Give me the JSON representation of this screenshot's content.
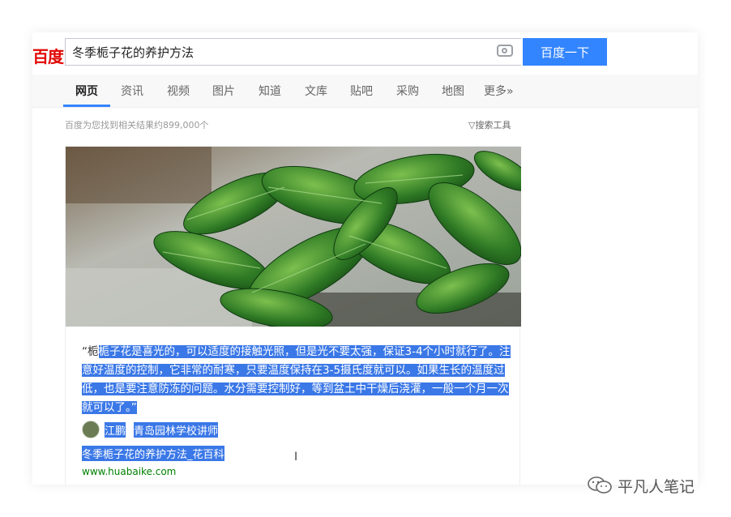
{
  "logo": "百度",
  "search": {
    "value": "冬季栀子花的养护方法",
    "button": "百度一下"
  },
  "nav": {
    "tabs": [
      {
        "label": "网页",
        "active": true
      },
      {
        "label": "资讯"
      },
      {
        "label": "视频"
      },
      {
        "label": "图片"
      },
      {
        "label": "知道"
      },
      {
        "label": "文库"
      },
      {
        "label": "贴吧"
      },
      {
        "label": "采购"
      },
      {
        "label": "地图"
      },
      {
        "label": "更多»"
      }
    ]
  },
  "results": {
    "count_text": "百度为您找到相关结果约899,000个",
    "tools_label": "搜索工具"
  },
  "card": {
    "quote_open": "“",
    "snippet_sel": "栀子花是喜光的，可以适度的接触光照，但是光不要太强，保证3-4个小时就行了。注意好温度的控制，它非常的耐寒，只要温度保持在3-5摄氏度就可以。如果生长的温度过低，也是要注意防冻的问题。水分需要控制好，等到盆土中干燥后浇灌，一般一个月一次就可以了。”",
    "snippet_first_char": "栀",
    "author_name": "江鹏",
    "author_title": "青岛园林学校讲师",
    "title": "冬季栀子花的养护方法_花百科",
    "url": "www.huabaike.com"
  },
  "watermark": "平凡人笔记",
  "colors": {
    "accent": "#3385ff",
    "selection": "#3b78e7",
    "url": "#008000",
    "logo": "#e10602"
  }
}
